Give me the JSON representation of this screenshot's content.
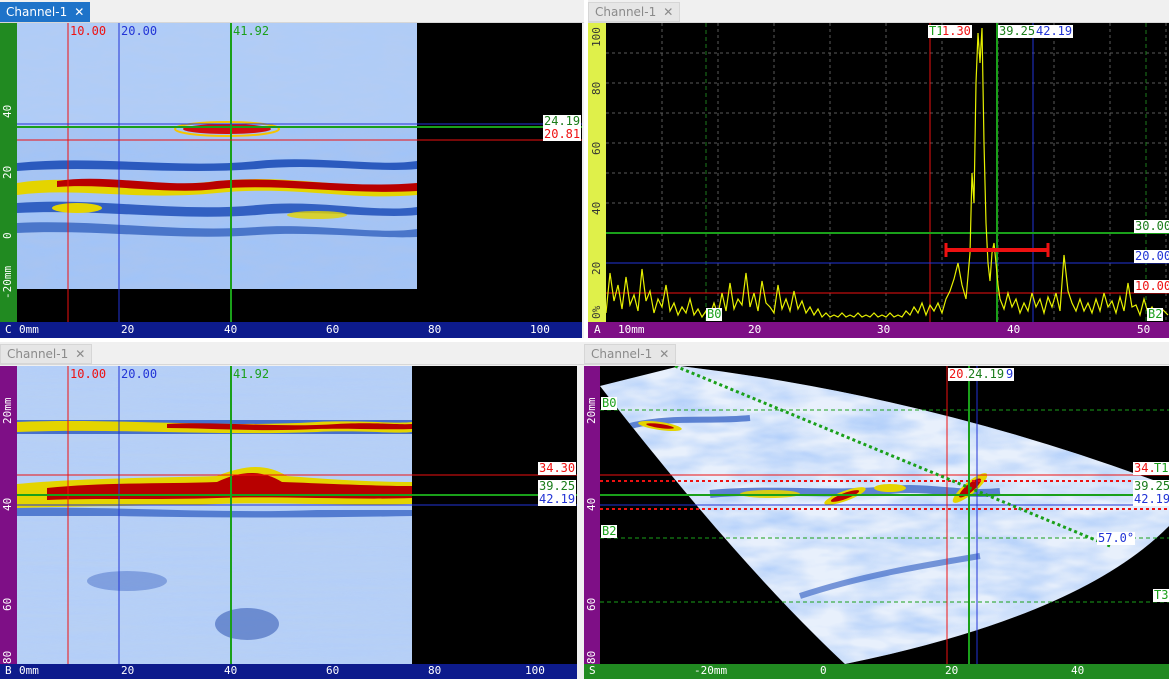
{
  "tabs": {
    "tl": "Channel-1",
    "tr": "Channel-1",
    "bl": "Channel-1",
    "br": "Channel-1"
  },
  "views": {
    "c": {
      "letter": "C",
      "cursors_top": [
        "10.00",
        "20.00",
        "41.92"
      ],
      "cursors_right": [
        "24.19",
        "20.81"
      ],
      "hticks": [
        "0mm",
        "20",
        "40",
        "60",
        "80",
        "100"
      ],
      "vticks": [
        "40",
        "20",
        "0",
        "-20mm"
      ]
    },
    "a": {
      "letter": "A",
      "gates": [
        "T1",
        "B0",
        "B2"
      ],
      "cursor_top": [
        "1.30",
        "39.25",
        "42.19"
      ],
      "cursor_right": [
        "30.00",
        "20.00",
        "10.00"
      ],
      "hticks": [
        "10mm",
        "20",
        "30",
        "40",
        "50"
      ],
      "vticks": [
        "100",
        "80",
        "60",
        "40",
        "20",
        "0%"
      ]
    },
    "b": {
      "letter": "B",
      "cursors_top": [
        "10.00",
        "20.00",
        "41.92"
      ],
      "cursors_right": [
        "34.30",
        "39.25",
        "42.19"
      ],
      "hticks": [
        "0mm",
        "20",
        "40",
        "60",
        "80",
        "100"
      ],
      "vticks": [
        "20mm",
        "40",
        "60",
        "80"
      ]
    },
    "s": {
      "letter": "S",
      "cursors_top": [
        "20.",
        "24.19",
        "9"
      ],
      "gates": [
        "B0",
        "B2",
        "T1",
        "T3"
      ],
      "cursors_right": [
        "34.",
        "39.25",
        "42.19"
      ],
      "angle": "57.0°",
      "hticks": [
        "-20mm",
        "0",
        "20",
        "40"
      ],
      "vticks": [
        "20mm",
        "40",
        "60",
        "80"
      ]
    }
  },
  "colors": {
    "ruler_green": "#218a21",
    "ruler_purple": "#7e0f86",
    "ruler_navy": "#0d1b8c",
    "ascan_yellow": "#e6f000"
  }
}
